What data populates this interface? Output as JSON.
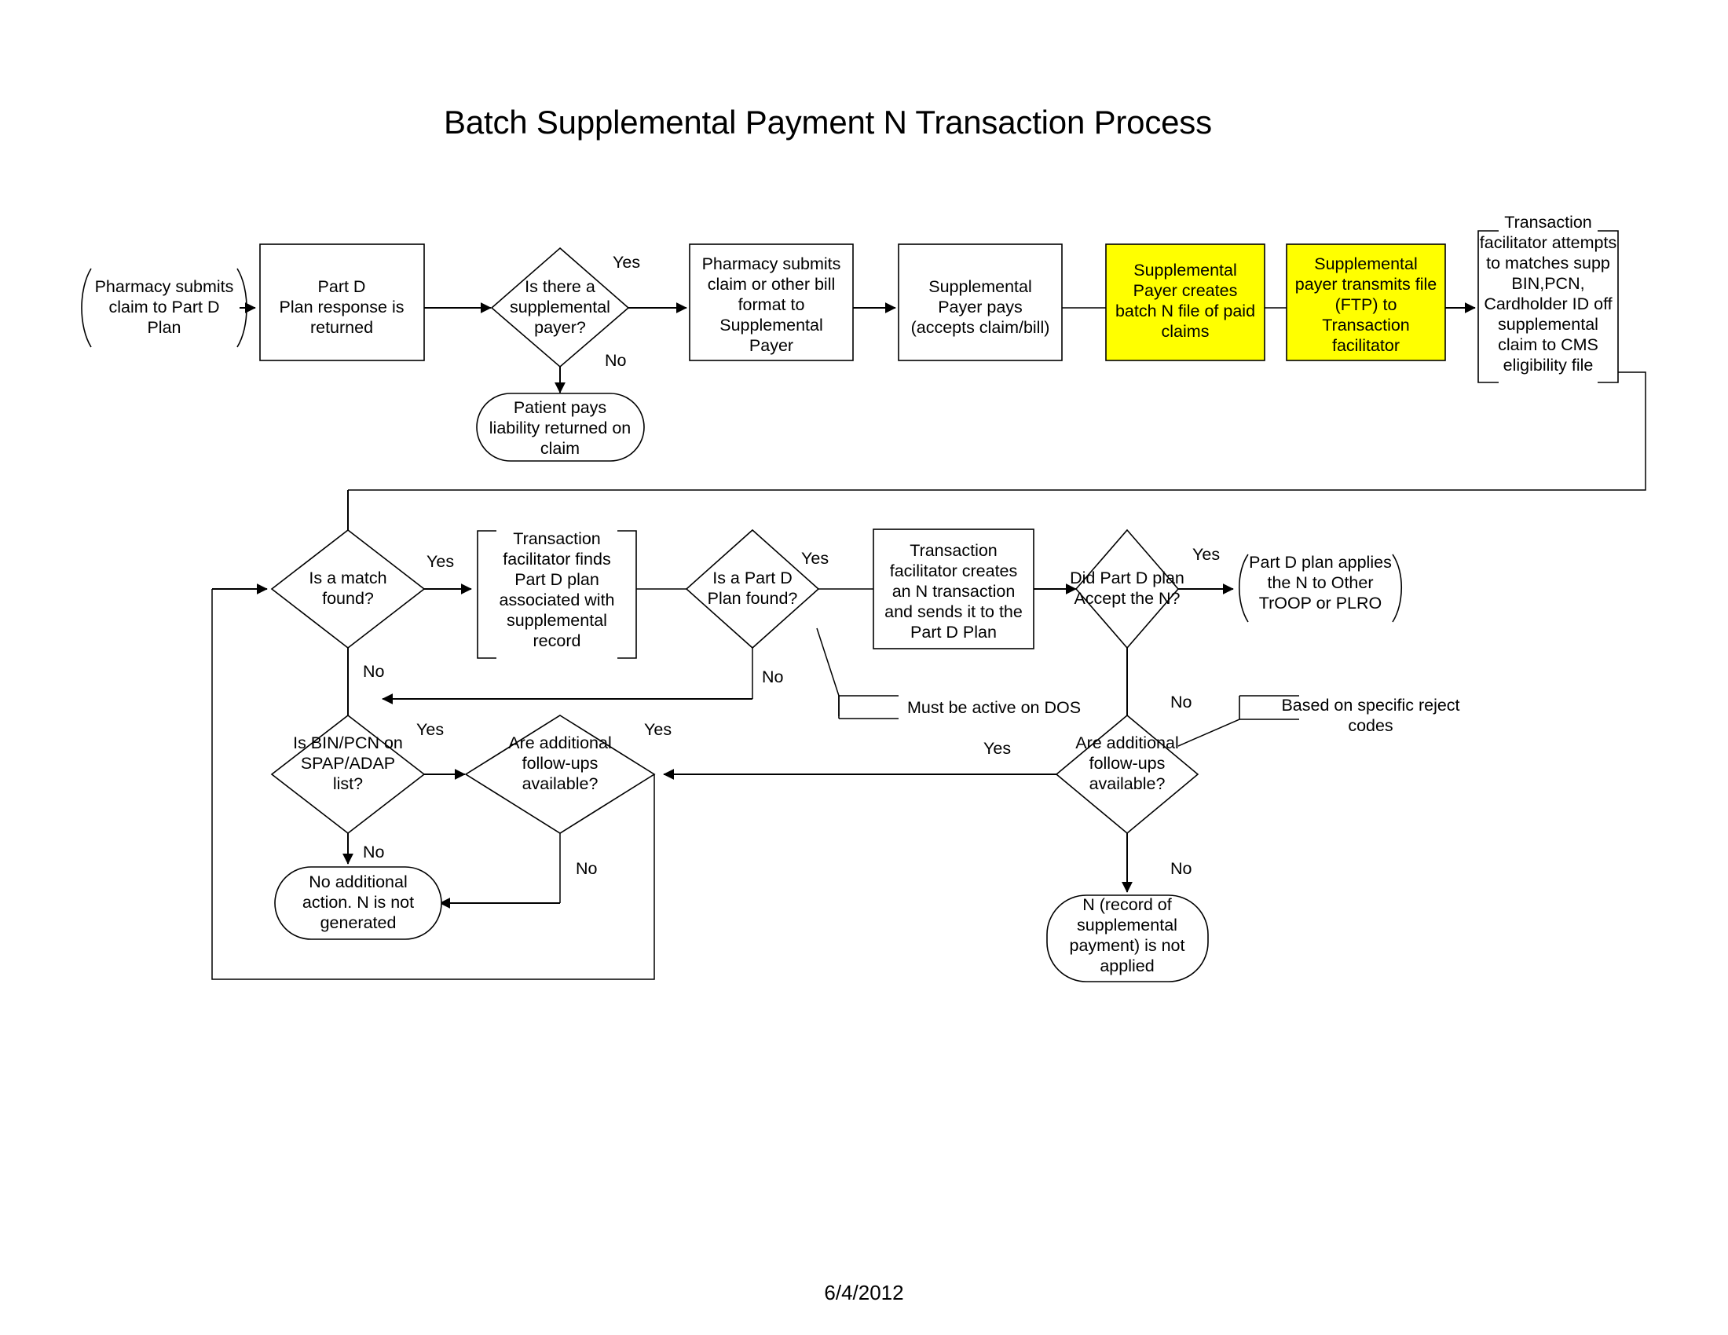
{
  "document": {
    "title": "Batch Supplemental Payment N Transaction Process",
    "date": "6/4/2012"
  },
  "colors": {
    "highlight": "#FFFF00",
    "shape_stroke": "#000000",
    "shape_fill": "#FFFFFF",
    "background": "#FFFFFF"
  },
  "nodes": {
    "pharmacy_submits_part_d": {
      "shape": "delay-curved",
      "lines": [
        "Pharmacy submits",
        "claim to Part D",
        "Plan"
      ]
    },
    "part_d_response": {
      "shape": "process",
      "lines": [
        "Part D",
        "Plan response is",
        "returned"
      ]
    },
    "is_supplemental_payer": {
      "shape": "decision",
      "lines": [
        "Is there a",
        "supplemental",
        "payer?"
      ]
    },
    "patient_pays": {
      "shape": "terminator",
      "lines": [
        "Patient pays",
        "liability returned on",
        "claim"
      ]
    },
    "pharmacy_submits_supp": {
      "shape": "process",
      "lines": [
        "Pharmacy submits",
        "claim or other bill",
        "format to",
        "Supplemental",
        "Payer"
      ]
    },
    "supplemental_payer_pays": {
      "shape": "process",
      "lines": [
        "Supplemental",
        "Payer pays",
        "(accepts claim/bill)"
      ]
    },
    "supp_payer_creates_batch": {
      "shape": "process-highlighted",
      "lines": [
        "Supplemental",
        "Payer creates",
        "batch N file of paid",
        "claims"
      ]
    },
    "supp_payer_transmits": {
      "shape": "process-highlighted",
      "lines": [
        "Supplemental",
        "payer transmits file",
        "(FTP) to",
        "Transaction",
        "facilitator"
      ]
    },
    "facilitator_matches": {
      "shape": "bracket",
      "lines": [
        "Transaction",
        "facilitator attempts",
        "to matches supp",
        "BIN,PCN,",
        "Cardholder ID off",
        "supplemental",
        "claim to CMS",
        "eligibility file"
      ]
    },
    "is_match_found": {
      "shape": "decision",
      "lines": [
        "Is a match",
        "found?"
      ]
    },
    "facilitator_finds_plan": {
      "shape": "bracket",
      "lines": [
        "Transaction",
        "facilitator finds",
        "Part D plan",
        "associated with",
        "supplemental",
        "record"
      ]
    },
    "is_part_d_plan_found": {
      "shape": "decision",
      "lines": [
        "Is a Part D",
        "Plan found?"
      ]
    },
    "facilitator_creates_n": {
      "shape": "process",
      "lines": [
        "Transaction",
        "facilitator creates",
        "an N transaction",
        "and sends it to the",
        "Part D Plan"
      ]
    },
    "must_be_active_note": {
      "shape": "callout",
      "lines": [
        "Must be active on DOS"
      ]
    },
    "did_plan_accept_n": {
      "shape": "decision",
      "lines": [
        "Did Part D plan",
        "Accept the N?"
      ]
    },
    "plan_applies_n": {
      "shape": "delay-curved",
      "lines": [
        "Part D plan applies",
        "the N to Other",
        "TrOOP or PLRO"
      ]
    },
    "is_bin_pcn_spap": {
      "shape": "decision",
      "lines": [
        "Is BIN/PCN on",
        "SPAP/ADAP",
        "list?"
      ]
    },
    "followups_left": {
      "shape": "decision",
      "lines": [
        "Are additional",
        "follow-ups",
        "available?"
      ]
    },
    "followups_right": {
      "shape": "decision",
      "lines": [
        "Are additional",
        "follow-ups",
        "available?"
      ]
    },
    "based_on_reject_note": {
      "shape": "callout",
      "lines": [
        "Based on specific reject",
        "codes"
      ]
    },
    "no_additional_action": {
      "shape": "terminator",
      "lines": [
        "No additional",
        "action. N is not",
        "generated"
      ]
    },
    "n_not_applied": {
      "shape": "terminator",
      "lines": [
        "N (record of",
        "supplemental",
        "payment) is not",
        "applied"
      ]
    }
  },
  "edge_labels": {
    "supp_payer_yes": "Yes",
    "supp_payer_no": "No",
    "match_found_yes": "Yes",
    "match_found_no": "No",
    "part_d_found_yes": "Yes",
    "part_d_found_no": "No",
    "accept_n_yes": "Yes",
    "accept_n_no": "No",
    "bin_pcn_yes": "Yes",
    "bin_pcn_no": "No",
    "followups_left_yes": "Yes",
    "followups_left_no": "No",
    "followups_right_yes": "Yes",
    "followups_right_no": "No"
  }
}
